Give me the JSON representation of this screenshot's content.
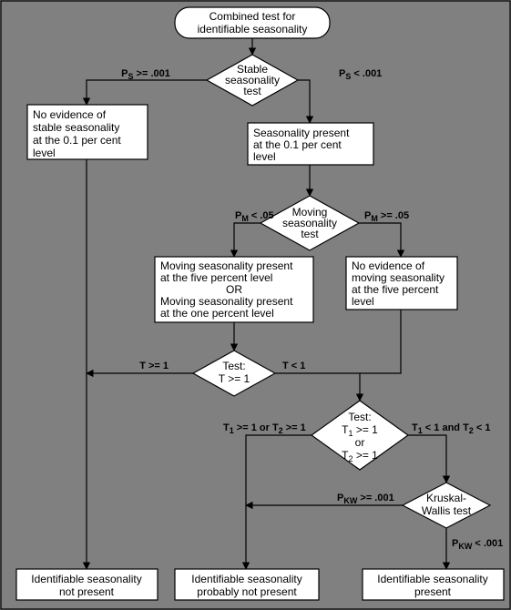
{
  "title1": "Combined test for",
  "title2": "identifiable seasonality",
  "stable1": "Stable",
  "stable2": "seasonality",
  "stable3": "test",
  "left_stable1": "No evidence of",
  "left_stable2": "stable seasonality",
  "left_stable3": "at the 0.1 per cent",
  "left_stable4": "level",
  "right_stable1": "Seasonality present",
  "right_stable2": "at the 0.1 per cent",
  "right_stable3": "level",
  "moving1": "Moving",
  "moving2": "seasonality",
  "moving3": "test",
  "moving_left1": "Moving seasonality present",
  "moving_left2": "at the five percent level",
  "moving_left3": "OR",
  "moving_left4": "Moving seasonality present",
  "moving_left5": "at the one percent level",
  "moving_right1": "No evidence of",
  "moving_right2": "moving seasonality",
  "moving_right3": "at the five percent",
  "moving_right4": "level",
  "test1a": "Test:",
  "test1b": "T >= 1",
  "test2a": "Test:",
  "test2_line1": "T₁ >= 1",
  "test2_line2": "or",
  "test2_line3": "T₂ >= 1",
  "kw1": "Kruskal-",
  "kw2": "Wallis test",
  "out_left1": "Identifiable seasonality",
  "out_left2": "not present",
  "out_mid1": "Identifiable seasonality",
  "out_mid2": "probably not present",
  "out_right1": "Identifiable  seasonality",
  "out_right2": "present",
  "edge_ps_ge": "Pₛ >= .001",
  "edge_ps_lt": "Pₛ < .001",
  "edge_pm_lt": "Pₘ < .05",
  "edge_pm_ge": "Pₘ >= .05",
  "edge_t_ge1": "T >= 1",
  "edge_t_lt1": "T < 1",
  "edge_t12_or": "T₁ >= 1 or T₂ >= 1",
  "edge_t12_and": "T₁ < 1 and T₂ < 1",
  "edge_pkw_ge": "Pₖw >= .001",
  "edge_pkw_lt": "Pₖw < .001"
}
